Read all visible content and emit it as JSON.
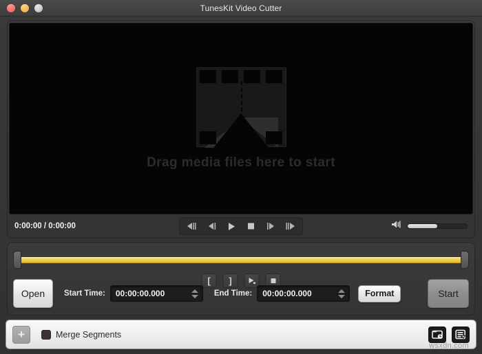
{
  "window": {
    "title": "TunesKit Video Cutter",
    "traffic_lights": [
      {
        "name": "close",
        "color": "#ee5f56"
      },
      {
        "name": "minimize",
        "color": "#e6a83c"
      },
      {
        "name": "zoom",
        "color": "#b9b9b9"
      }
    ]
  },
  "video": {
    "placeholder_text": "Drag media files here to start",
    "placeholder_icon": "film-strip-cut-icon",
    "stage_color": "#050505"
  },
  "transport": {
    "time_readout": "0:00:00 / 0:00:00",
    "buttons": [
      {
        "name": "step-backward-frame-icon",
        "label": "Previous frame"
      },
      {
        "name": "rewind-icon",
        "label": "Rewind"
      },
      {
        "name": "play-icon",
        "label": "Play"
      },
      {
        "name": "stop-icon",
        "label": "Stop"
      },
      {
        "name": "fast-forward-icon",
        "label": "Forward"
      },
      {
        "name": "step-forward-frame-icon",
        "label": "Next frame"
      }
    ],
    "volume": {
      "icon": "speaker-volume-icon",
      "level_percent": 50
    }
  },
  "trim": {
    "timeline": {
      "bar_color": "#efcc55",
      "handle_left": "trim-start-handle",
      "handle_right": "trim-end-handle"
    },
    "cut_buttons": [
      {
        "name": "set-start-marker-button",
        "glyph": "["
      },
      {
        "name": "set-end-marker-button",
        "glyph": "]"
      },
      {
        "name": "preview-segment-button",
        "glyph": "play"
      },
      {
        "name": "stop-preview-button",
        "glyph": "stop"
      }
    ],
    "open_label": "Open",
    "start_time_label": "Start Time:",
    "start_time_value": "00:00:00.000",
    "end_time_label": "End Time:",
    "end_time_value": "00:00:00.000",
    "time_placeholder": "00:00:00.000",
    "format_label": "Format",
    "start_label": "Start"
  },
  "bottom": {
    "add_label": "+",
    "merge_label": "Merge Segments",
    "merge_checked": false,
    "icons": [
      {
        "name": "output-folder-history-icon"
      },
      {
        "name": "task-list-icon"
      }
    ],
    "watermark": "wsxdn.com"
  }
}
